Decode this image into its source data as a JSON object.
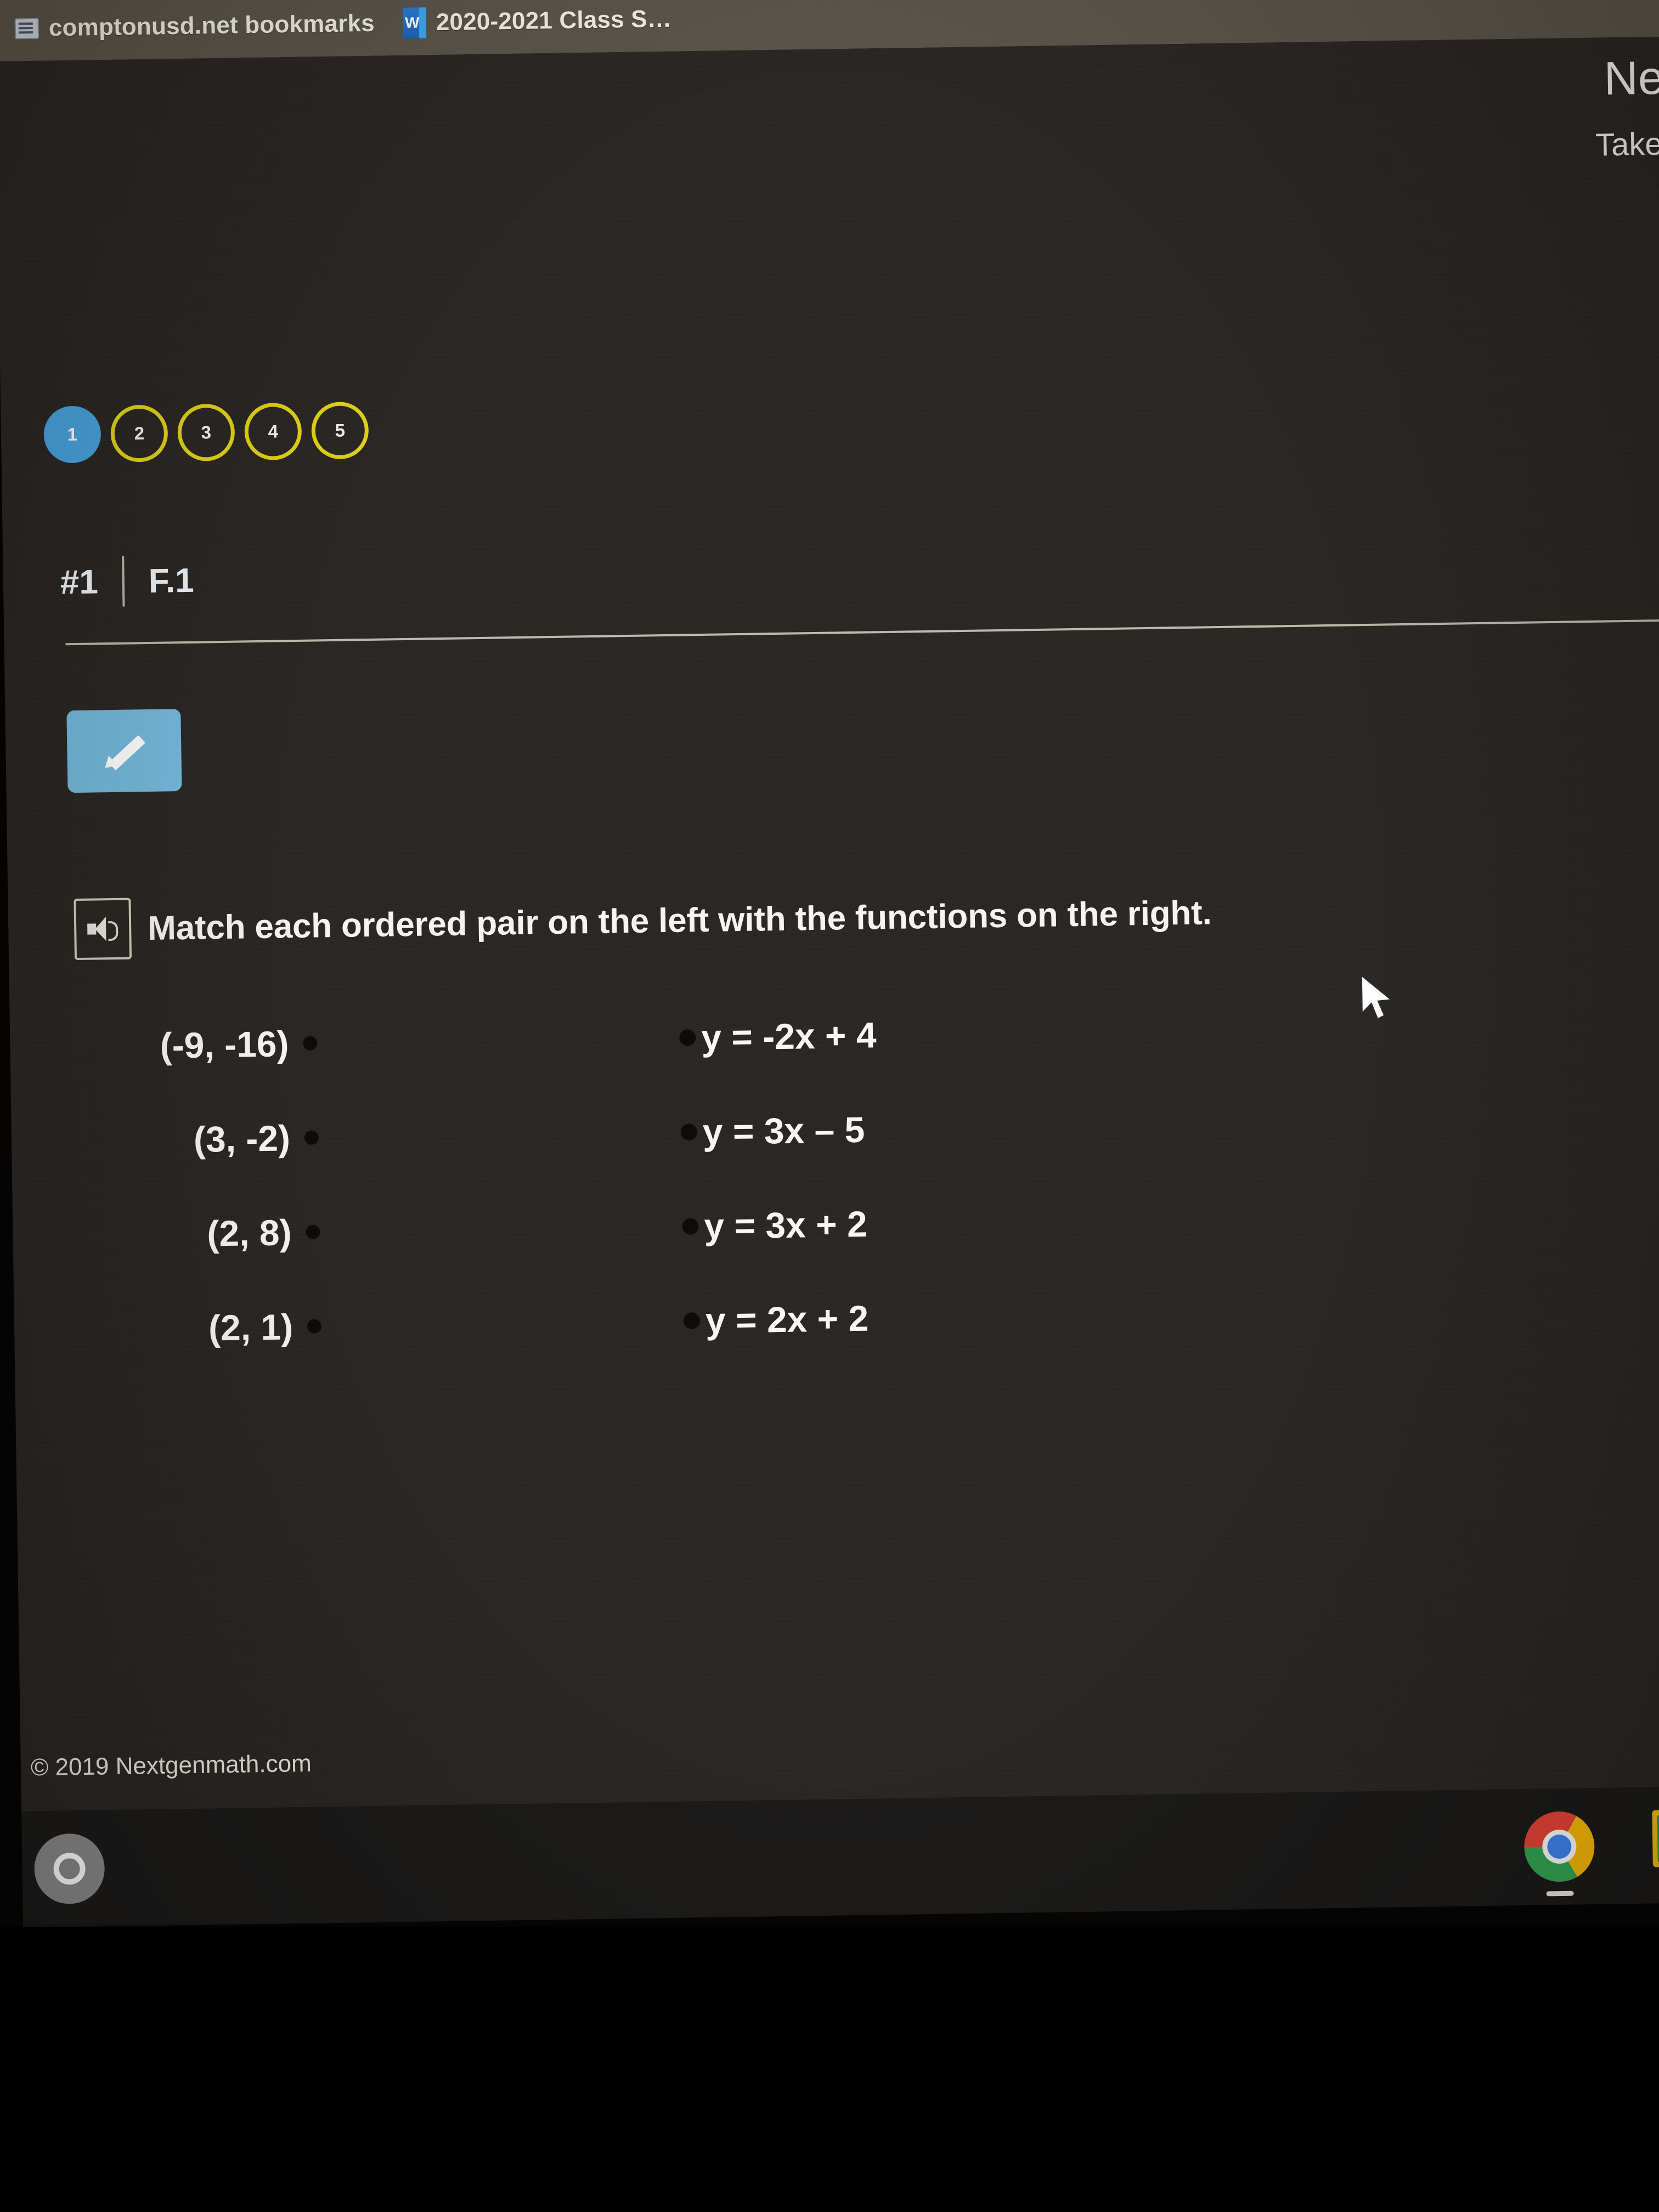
{
  "browser": {
    "bookmarks": [
      {
        "icon": "folder-icon",
        "label": "comptonusd.net bookmarks"
      },
      {
        "icon": "word-document-icon",
        "icon_letter": "W",
        "label": "2020-2021 Class S…"
      }
    ]
  },
  "header": {
    "next_button_label": "Next",
    "taken_by_label": "Taken by:"
  },
  "question_nav": {
    "items": [
      {
        "number": "1",
        "state": "active"
      },
      {
        "number": "2",
        "state": "idle"
      },
      {
        "number": "3",
        "state": "idle"
      },
      {
        "number": "4",
        "state": "idle"
      },
      {
        "number": "5",
        "state": "idle"
      }
    ],
    "active_color": "#4aa3dd",
    "idle_border_color": "#e2d218"
  },
  "question_header": {
    "number": "#1",
    "standard": "F.1"
  },
  "toolbar": {
    "pencil_icon": "pencil-icon",
    "pencil_button_color": "#76b9dd"
  },
  "prompt": {
    "audio_icon": "speaker-icon",
    "text": "Match each ordered pair on the left with the functions on the right."
  },
  "matching": {
    "left_items": [
      {
        "label": "(-9, -16)"
      },
      {
        "label": "(3, -2)"
      },
      {
        "label": "(2, 8)"
      },
      {
        "label": "(2, 1)"
      }
    ],
    "right_items": [
      {
        "label": "y = -2x + 4"
      },
      {
        "label": "y = 3x – 5"
      },
      {
        "label": "y = 3x + 2"
      },
      {
        "label": "y = 2x + 2"
      }
    ]
  },
  "footer": {
    "copyright": "© 2019 Nextgenmath.com"
  },
  "shelf": {
    "launcher_icon": "launcher-circle-icon",
    "apps": [
      {
        "icon": "chrome-icon",
        "active": true
      },
      {
        "icon": "google-classroom-icon",
        "active": true
      }
    ]
  },
  "cursor": {
    "icon": "mouse-pointer-icon"
  }
}
